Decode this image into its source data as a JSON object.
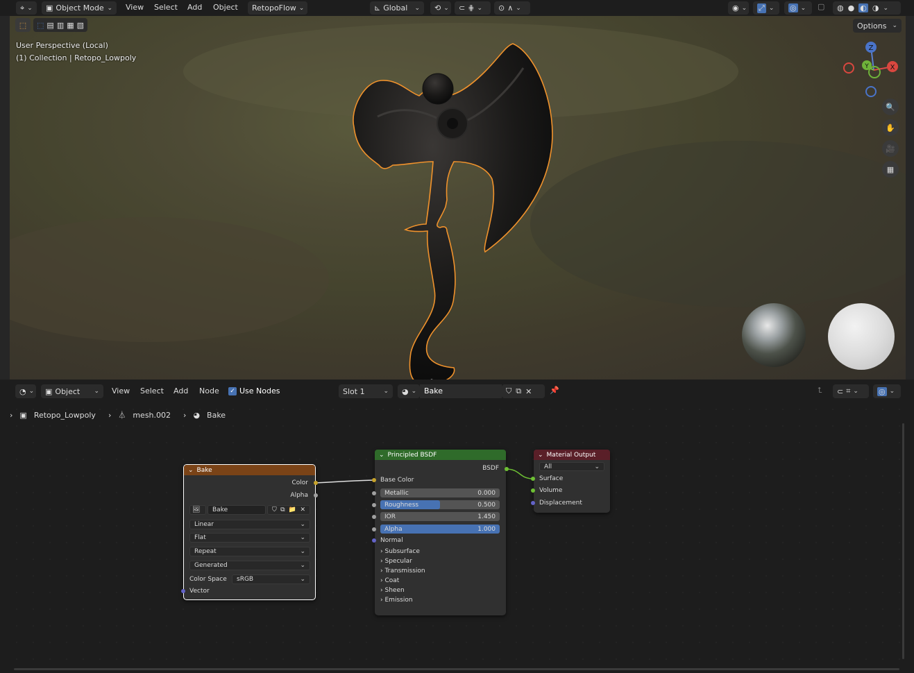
{
  "top_header": {
    "mode": "Object Mode",
    "menus": [
      "View",
      "Select",
      "Add",
      "Object"
    ],
    "addon": "RetopoFlow",
    "transform_orientation": "Global",
    "options": "Options"
  },
  "viewport": {
    "perspective": "User Perspective (Local)",
    "collection": "(1) Collection | Retopo_Lowpoly",
    "gizmo": {
      "z": "Z",
      "y": "Y",
      "x": "X"
    }
  },
  "node_header": {
    "editor": "Object",
    "menus": [
      "View",
      "Select",
      "Add",
      "Node"
    ],
    "use_nodes": "Use Nodes",
    "slot": "Slot 1",
    "material": "Bake"
  },
  "breadcrumb": {
    "object": "Retopo_Lowpoly",
    "mesh": "mesh.002",
    "material": "Bake"
  },
  "nodes": {
    "image": {
      "title": "Bake",
      "out_color": "Color",
      "out_alpha": "Alpha",
      "image_name": "Bake",
      "interpolation": "Linear",
      "projection": "Flat",
      "extension": "Repeat",
      "source": "Generated",
      "color_space_label": "Color Space",
      "color_space": "sRGB",
      "vector": "Vector"
    },
    "bsdf": {
      "title": "Principled BSDF",
      "out": "BSDF",
      "base_color": "Base Color",
      "metallic_label": "Metallic",
      "metallic": "0.000",
      "metallic_fill": 0.0,
      "roughness_label": "Roughness",
      "roughness": "0.500",
      "roughness_fill": 0.5,
      "ior_label": "IOR",
      "ior": "1.450",
      "ior_fill": 0.0,
      "alpha_label": "Alpha",
      "alpha": "1.000",
      "alpha_fill": 1.0,
      "normal": "Normal",
      "panels": [
        "Subsurface",
        "Specular",
        "Transmission",
        "Coat",
        "Sheen",
        "Emission"
      ]
    },
    "output": {
      "title": "Material Output",
      "target": "All",
      "surface": "Surface",
      "volume": "Volume",
      "displacement": "Displacement"
    }
  },
  "colors": {
    "selection_outline": "#f0922c",
    "active_blue": "#4772b3",
    "image_node_header": "#7a4317",
    "shader_node_header": "#2f6b2a",
    "output_node_header": "#5a1f28"
  }
}
